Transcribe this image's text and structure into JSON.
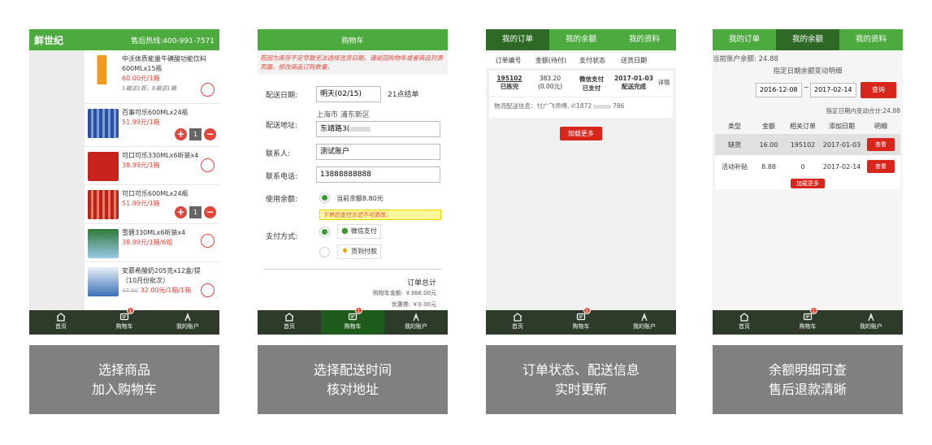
{
  "panel1": {
    "logo": "鲜世纪",
    "hotline": "售后热线:400-991-7571",
    "products": [
      {
        "name": "中沃体质能量牛磺酸功能饮料600MLx15瓶",
        "price": "60.00元/1箱",
        "note": "1箱送1瓶，8箱送1箱"
      },
      {
        "name": "百事可乐600MLx24瓶",
        "price": "51.99元/1箱",
        "qty": "1"
      },
      {
        "name": "可口可乐330MLx6听装x4",
        "price": "38.99元/1箱"
      },
      {
        "name": "可口可乐600MLx24瓶",
        "price": "51.99元/1箱",
        "qty": "1"
      },
      {
        "name": "雪碧330MLx6听装x4",
        "price": "38.99元/1箱/6组"
      },
      {
        "name": "安慕希酸奶205克x12盒/提",
        "name2": "（10月份批次）",
        "old_price": "47.50",
        "price": "32.00元/1箱/1箱"
      }
    ]
  },
  "panel2": {
    "title": "购物车",
    "warning": "若因为库存不足导致无法选择送货日期，请返回购物车或者商品列表页面，修改商品订购数量。",
    "date_label": "配送日期:",
    "date_value": "明天(02/15)",
    "cutoff": "21点结单",
    "addr_label": "配送地址:",
    "addr_region": "上海市 浦东新区",
    "addr_value": "东靖路3(",
    "contact_label": "联系人:",
    "contact_value": "测试账户",
    "phone_label": "联系电话:",
    "phone_value": "13888888888",
    "balance_label": "使用余额:",
    "balance_value": "当前余额8.80元",
    "pay_warn": "下单后支付方式不可更改。",
    "pay_label": "支付方式:",
    "pay_wechat": "微信支付",
    "pay_cod": "货到付款",
    "total_title": "订单总计",
    "cart_amount": "购物车金额: ￥366.00元",
    "coupon": "优惠券: ￥0.00元"
  },
  "panel3": {
    "tabs": [
      "我的订单",
      "我的余额",
      "我的资料"
    ],
    "headers": [
      "订单编号",
      "金额(待付)",
      "支付状态",
      "送货日期"
    ],
    "order": {
      "id": "195102",
      "status1": "已拣完",
      "amount": "383.20",
      "pending": "(0.00元)",
      "pay": "微信支付",
      "pay_status": "已支付",
      "date": "2017-01-03",
      "delivery": "配送完成",
      "detail": "详情"
    },
    "logistics": "物流配送信息：付广飞师傅, ✆1872",
    "logistics_tail": "786",
    "load_more": "加载更多"
  },
  "panel4": {
    "tabs": [
      "我的订单",
      "我的余额",
      "我的资料"
    ],
    "balance_line": "当前账户余额: 24.88",
    "subtitle": "指定日期余额变动明细",
    "date_from": "2016-12-08",
    "date_sep": "~",
    "date_to": "2017-02-14",
    "query": "查询",
    "sum_line": "指定日期内变动合计:24.88",
    "headers": [
      "类型",
      "金额",
      "相关订单",
      "添加日期",
      "明细"
    ],
    "rows": [
      {
        "type": "缺货",
        "amount": "16.00",
        "order": "195102",
        "date": "2017-01-03",
        "btn": "查看"
      },
      {
        "type": "活动补贴",
        "amount": "8.88",
        "order": "0",
        "date": "2017-02-14",
        "btn": "查看"
      }
    ],
    "load_more": "加载更多"
  },
  "bottom_nav": {
    "home": "首页",
    "cart": "购物车",
    "account": "我的账户",
    "badge": "1"
  },
  "captions": [
    {
      "l1": "选择商品",
      "l2": "加入购物车"
    },
    {
      "l1": "选择配送时间",
      "l2": "核对地址"
    },
    {
      "l1": "订单状态、配送信息",
      "l2": "实时更新"
    },
    {
      "l1": "余额明细可查",
      "l2": "售后退款清晰"
    }
  ],
  "colors": {
    "green": "#4caa3f",
    "dark_green": "#2e6a26",
    "red": "#d9261c",
    "caption_bg": "#808080"
  }
}
